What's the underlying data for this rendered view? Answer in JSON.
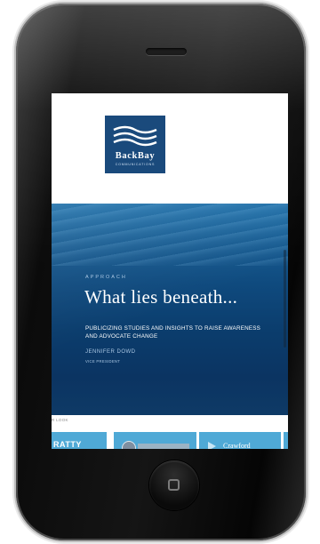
{
  "logo": {
    "name": "BackBay",
    "subtitle": "COMMUNICATIONS"
  },
  "hero": {
    "eyebrow": "APPROACH",
    "title": "What lies beneath...",
    "text": "PUBLICIZING STUDIES AND INSIGHTS TO RAISE AWARENESS AND ADVOCATE CHANGE",
    "author": "JENNIFER DOWD",
    "role": "VICE PRESIDENT"
  },
  "strip": {
    "label": "R LOOK",
    "tiles": [
      "RATTY",
      "",
      "Crawford"
    ]
  },
  "colors": {
    "brand_blue": "#1a4a7c",
    "tile_blue": "#4fa9d6",
    "phone_body": "#111111"
  }
}
